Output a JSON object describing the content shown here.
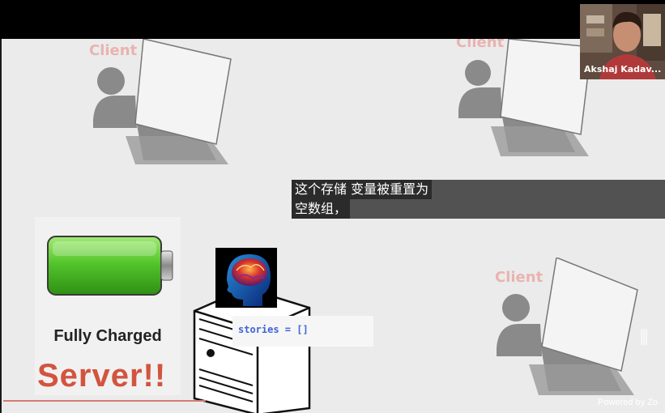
{
  "slide": {
    "client_label": "Client",
    "battery_caption": "Fully Charged",
    "battery_subtext": "",
    "server_title": "Server!!",
    "server_code": "stories = []",
    "colors": {
      "server_title": "#d2543f",
      "client_label": "#e9b3b0",
      "code": "#3f64d4",
      "battery": "#54c62c"
    }
  },
  "subtitle": {
    "line1": "这个存储 变量被重置为",
    "line2": "空数组，"
  },
  "video": {
    "speaker_name": "Akshaj Kadav...",
    "watermark": "Powered by Zo",
    "brand_glyph": "⫼"
  }
}
